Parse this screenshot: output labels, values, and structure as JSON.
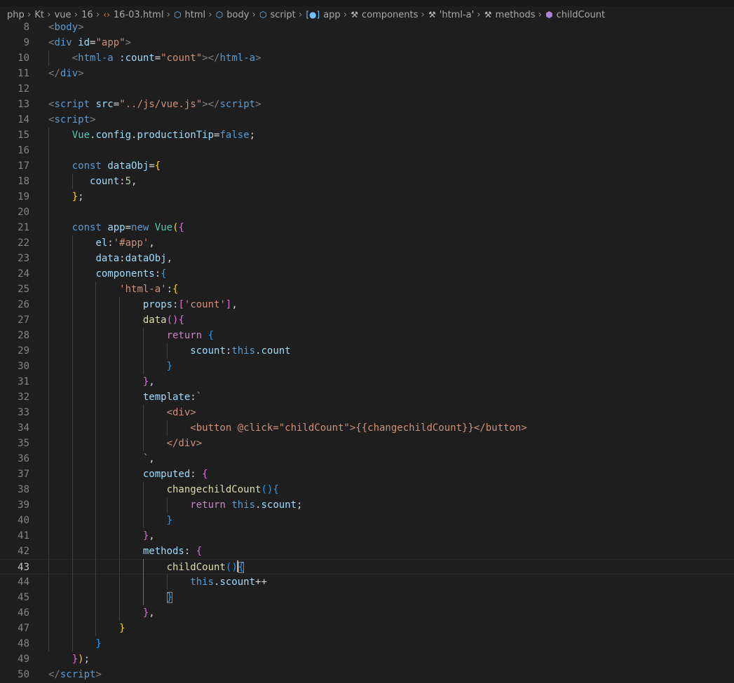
{
  "breadcrumb": [
    {
      "label": "php",
      "icon": null
    },
    {
      "label": "Kt",
      "icon": null
    },
    {
      "label": "vue",
      "icon": null
    },
    {
      "label": "16",
      "icon": null
    },
    {
      "label": "16-03.html",
      "icon": "html-file-icon"
    },
    {
      "label": "html",
      "icon": "element-tag-icon"
    },
    {
      "label": "body",
      "icon": "element-tag-icon"
    },
    {
      "label": "script",
      "icon": "element-tag-icon"
    },
    {
      "label": "app",
      "icon": "variable-icon"
    },
    {
      "label": "components",
      "icon": "property-wrench-icon"
    },
    {
      "label": "'html-a'",
      "icon": "property-wrench-icon"
    },
    {
      "label": "methods",
      "icon": "property-wrench-icon"
    },
    {
      "label": "childCount",
      "icon": "method-cube-icon"
    }
  ],
  "colors": {
    "background": "#1e1e1e",
    "line_number": "#858585",
    "tag": "#569cd6",
    "attribute": "#9cdcfe",
    "string": "#ce9178",
    "function": "#dcdcaa",
    "class": "#4ec9b0",
    "control_keyword": "#c586c0",
    "bracket_level1": "#ffd700",
    "bracket_level2": "#da70d6",
    "bracket_level3": "#179fff"
  },
  "editor": {
    "current_line": 43,
    "lines": [
      {
        "n": "8",
        "tokens": [
          [
            "t-tagp",
            "<"
          ],
          [
            "t-tag",
            "body"
          ],
          [
            "t-tagp",
            ">"
          ]
        ]
      },
      {
        "n": "9",
        "tokens": [
          [
            "t-tagp",
            "<"
          ],
          [
            "t-tag",
            "div"
          ],
          [
            "t-txt",
            " "
          ],
          [
            "t-attr",
            "id"
          ],
          [
            "t-txt",
            "="
          ],
          [
            "t-str",
            "\"app\""
          ],
          [
            "t-tagp",
            ">"
          ]
        ]
      },
      {
        "n": "10",
        "tokens": [
          [
            "t-txt",
            "    "
          ],
          [
            "t-tagp",
            "<"
          ],
          [
            "t-tag",
            "html-a"
          ],
          [
            "t-txt",
            " "
          ],
          [
            "t-attr",
            ":count"
          ],
          [
            "t-txt",
            "="
          ],
          [
            "t-str",
            "\"count\""
          ],
          [
            "t-tagp",
            "></"
          ],
          [
            "t-tag",
            "html-a"
          ],
          [
            "t-tagp",
            ">"
          ]
        ]
      },
      {
        "n": "11",
        "tokens": [
          [
            "t-tagp",
            "</"
          ],
          [
            "t-tag",
            "div"
          ],
          [
            "t-tagp",
            ">"
          ]
        ]
      },
      {
        "n": "12",
        "tokens": []
      },
      {
        "n": "13",
        "tokens": [
          [
            "t-tagp",
            "<"
          ],
          [
            "t-tag",
            "script"
          ],
          [
            "t-txt",
            " "
          ],
          [
            "t-attr",
            "src"
          ],
          [
            "t-txt",
            "="
          ],
          [
            "t-str",
            "\"../js/vue.js\""
          ],
          [
            "t-tagp",
            "></"
          ],
          [
            "t-tag",
            "script"
          ],
          [
            "t-tagp",
            ">"
          ]
        ]
      },
      {
        "n": "14",
        "tokens": [
          [
            "t-tagp",
            "<"
          ],
          [
            "t-tag",
            "script"
          ],
          [
            "t-tagp",
            ">"
          ]
        ]
      },
      {
        "n": "15",
        "tokens": [
          [
            "t-txt",
            "    "
          ],
          [
            "t-cls",
            "Vue"
          ],
          [
            "t-txt",
            "."
          ],
          [
            "t-var",
            "config"
          ],
          [
            "t-txt",
            "."
          ],
          [
            "t-var",
            "productionTip"
          ],
          [
            "t-txt",
            "="
          ],
          [
            "t-kw",
            "false"
          ],
          [
            "t-txt",
            ";"
          ]
        ]
      },
      {
        "n": "16",
        "tokens": []
      },
      {
        "n": "17",
        "tokens": [
          [
            "t-txt",
            "    "
          ],
          [
            "t-kw",
            "const"
          ],
          [
            "t-txt",
            " "
          ],
          [
            "t-var",
            "dataObj"
          ],
          [
            "t-txt",
            "="
          ],
          [
            "b1",
            "{"
          ]
        ]
      },
      {
        "n": "18",
        "tokens": [
          [
            "t-txt",
            "       "
          ],
          [
            "t-var",
            "count"
          ],
          [
            "t-txt",
            ":"
          ],
          [
            "t-num",
            "5"
          ],
          [
            "t-txt",
            ","
          ]
        ]
      },
      {
        "n": "19",
        "tokens": [
          [
            "t-txt",
            "    "
          ],
          [
            "b1",
            "}"
          ],
          [
            "t-txt",
            ";"
          ]
        ]
      },
      {
        "n": "20",
        "tokens": []
      },
      {
        "n": "21",
        "tokens": [
          [
            "t-txt",
            "    "
          ],
          [
            "t-kw",
            "const"
          ],
          [
            "t-txt",
            " "
          ],
          [
            "t-var",
            "app"
          ],
          [
            "t-txt",
            "="
          ],
          [
            "t-kw",
            "new"
          ],
          [
            "t-txt",
            " "
          ],
          [
            "t-cls",
            "Vue"
          ],
          [
            "b1",
            "("
          ],
          [
            "b2",
            "{"
          ]
        ]
      },
      {
        "n": "22",
        "tokens": [
          [
            "t-txt",
            "        "
          ],
          [
            "t-var",
            "el"
          ],
          [
            "t-txt",
            ":"
          ],
          [
            "t-str",
            "'#app'"
          ],
          [
            "t-txt",
            ","
          ]
        ]
      },
      {
        "n": "23",
        "tokens": [
          [
            "t-txt",
            "        "
          ],
          [
            "t-var",
            "data"
          ],
          [
            "t-txt",
            ":"
          ],
          [
            "t-var",
            "dataObj"
          ],
          [
            "t-txt",
            ","
          ]
        ]
      },
      {
        "n": "24",
        "tokens": [
          [
            "t-txt",
            "        "
          ],
          [
            "t-var",
            "components"
          ],
          [
            "t-txt",
            ":"
          ],
          [
            "b3",
            "{"
          ]
        ]
      },
      {
        "n": "25",
        "tokens": [
          [
            "t-txt",
            "            "
          ],
          [
            "t-str",
            "'html-a'"
          ],
          [
            "t-txt",
            ":"
          ],
          [
            "b1",
            "{"
          ]
        ]
      },
      {
        "n": "26",
        "tokens": [
          [
            "t-txt",
            "                "
          ],
          [
            "t-var",
            "props"
          ],
          [
            "t-txt",
            ":"
          ],
          [
            "b2",
            "["
          ],
          [
            "t-str",
            "'count'"
          ],
          [
            "b2",
            "]"
          ],
          [
            "t-txt",
            ","
          ]
        ]
      },
      {
        "n": "27",
        "tokens": [
          [
            "t-txt",
            "                "
          ],
          [
            "t-fn",
            "data"
          ],
          [
            "b2",
            "("
          ],
          [
            "b2",
            ")"
          ],
          [
            "b2",
            "{"
          ]
        ]
      },
      {
        "n": "28",
        "tokens": [
          [
            "t-txt",
            "                    "
          ],
          [
            "t-ctl",
            "return"
          ],
          [
            "t-txt",
            " "
          ],
          [
            "b3",
            "{"
          ]
        ]
      },
      {
        "n": "29",
        "tokens": [
          [
            "t-txt",
            "                        "
          ],
          [
            "t-var",
            "scount"
          ],
          [
            "t-txt",
            ":"
          ],
          [
            "t-kw",
            "this"
          ],
          [
            "t-txt",
            "."
          ],
          [
            "t-var",
            "count"
          ]
        ]
      },
      {
        "n": "30",
        "tokens": [
          [
            "t-txt",
            "                    "
          ],
          [
            "b3",
            "}"
          ]
        ]
      },
      {
        "n": "31",
        "tokens": [
          [
            "t-txt",
            "                "
          ],
          [
            "b2",
            "}"
          ],
          [
            "t-txt",
            ","
          ]
        ]
      },
      {
        "n": "32",
        "tokens": [
          [
            "t-txt",
            "                "
          ],
          [
            "t-var",
            "template"
          ],
          [
            "t-txt",
            ":"
          ],
          [
            "t-str",
            "`"
          ]
        ]
      },
      {
        "n": "33",
        "tokens": [
          [
            "t-str",
            "                    <div>"
          ]
        ]
      },
      {
        "n": "34",
        "tokens": [
          [
            "t-str",
            "                        <button @click=\"childCount\">{{changechildCount}}</button>"
          ]
        ]
      },
      {
        "n": "35",
        "tokens": [
          [
            "t-str",
            "                    </div>"
          ]
        ]
      },
      {
        "n": "36",
        "tokens": [
          [
            "t-str",
            "                `"
          ],
          [
            "t-txt",
            ","
          ]
        ]
      },
      {
        "n": "37",
        "tokens": [
          [
            "t-txt",
            "                "
          ],
          [
            "t-var",
            "computed"
          ],
          [
            "t-txt",
            ": "
          ],
          [
            "b2",
            "{"
          ]
        ]
      },
      {
        "n": "38",
        "tokens": [
          [
            "t-txt",
            "                    "
          ],
          [
            "t-fn",
            "changechildCount"
          ],
          [
            "b3",
            "("
          ],
          [
            "b3",
            ")"
          ],
          [
            "b3",
            "{"
          ]
        ]
      },
      {
        "n": "39",
        "tokens": [
          [
            "t-txt",
            "                        "
          ],
          [
            "t-ctl",
            "return"
          ],
          [
            "t-txt",
            " "
          ],
          [
            "t-kw",
            "this"
          ],
          [
            "t-txt",
            "."
          ],
          [
            "t-var",
            "scount"
          ],
          [
            "t-txt",
            ";"
          ]
        ]
      },
      {
        "n": "40",
        "tokens": [
          [
            "t-txt",
            "                    "
          ],
          [
            "b3",
            "}"
          ]
        ]
      },
      {
        "n": "41",
        "tokens": [
          [
            "t-txt",
            "                "
          ],
          [
            "b2",
            "}"
          ],
          [
            "t-txt",
            ","
          ]
        ]
      },
      {
        "n": "42",
        "tokens": [
          [
            "t-txt",
            "                "
          ],
          [
            "t-var",
            "methods"
          ],
          [
            "t-txt",
            ": "
          ],
          [
            "b2",
            "{"
          ]
        ]
      },
      {
        "n": "43",
        "tokens": [
          [
            "t-txt",
            "                    "
          ],
          [
            "t-fn",
            "childCount"
          ],
          [
            "b3",
            "("
          ],
          [
            "b3",
            ")"
          ],
          [
            "b3 bm",
            "{"
          ]
        ]
      },
      {
        "n": "44",
        "tokens": [
          [
            "t-txt",
            "                        "
          ],
          [
            "t-kw",
            "this"
          ],
          [
            "t-txt",
            "."
          ],
          [
            "t-var",
            "scount"
          ],
          [
            "t-txt",
            "++"
          ]
        ]
      },
      {
        "n": "45",
        "tokens": [
          [
            "t-txt",
            "                    "
          ],
          [
            "b3 bm",
            "}"
          ]
        ]
      },
      {
        "n": "46",
        "tokens": [
          [
            "t-txt",
            "                "
          ],
          [
            "b2",
            "}"
          ],
          [
            "t-txt",
            ","
          ]
        ]
      },
      {
        "n": "47",
        "tokens": [
          [
            "t-txt",
            "            "
          ],
          [
            "b1",
            "}"
          ]
        ]
      },
      {
        "n": "48",
        "tokens": [
          [
            "t-txt",
            "        "
          ],
          [
            "b3",
            "}"
          ]
        ]
      },
      {
        "n": "49",
        "tokens": [
          [
            "t-txt",
            "    "
          ],
          [
            "b2",
            "}"
          ],
          [
            "b1",
            ")"
          ],
          [
            "t-txt",
            ";"
          ]
        ]
      },
      {
        "n": "50",
        "tokens": [
          [
            "t-tagp",
            "</"
          ],
          [
            "t-tag",
            "script"
          ],
          [
            "t-tagp",
            ">"
          ]
        ]
      }
    ]
  }
}
